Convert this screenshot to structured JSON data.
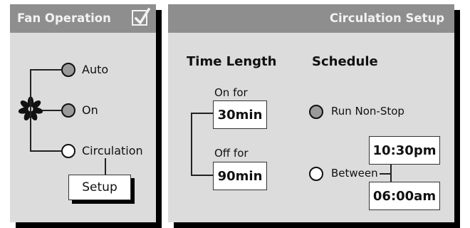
{
  "fan_operation": {
    "title": "Fan Operation",
    "enabled_checkbox_checked": true,
    "options": [
      {
        "label": "Auto",
        "selected": true
      },
      {
        "label": "On",
        "selected": true
      },
      {
        "label": "Circulation",
        "selected": false
      }
    ],
    "setup_button": "Setup"
  },
  "circulation_setup": {
    "title": "Circulation Setup",
    "time_length": {
      "heading": "Time Length",
      "on_label": "On for",
      "on_value": "30min",
      "off_label": "Off for",
      "off_value": "90min"
    },
    "schedule": {
      "heading": "Schedule",
      "run_nonstop_label": "Run Non-Stop",
      "between_label": "Between",
      "start_time": "10:30pm",
      "end_time": "06:00am"
    }
  },
  "colors": {
    "panel_bg": "#dcdcdc",
    "header_bg": "#8e8e8e",
    "header_text": "#f2f2f2",
    "radio_selected": "#9a9a9a",
    "radio_unselected": "#ffffff"
  },
  "icons": [
    "checkmark-icon",
    "fan-icon"
  ]
}
